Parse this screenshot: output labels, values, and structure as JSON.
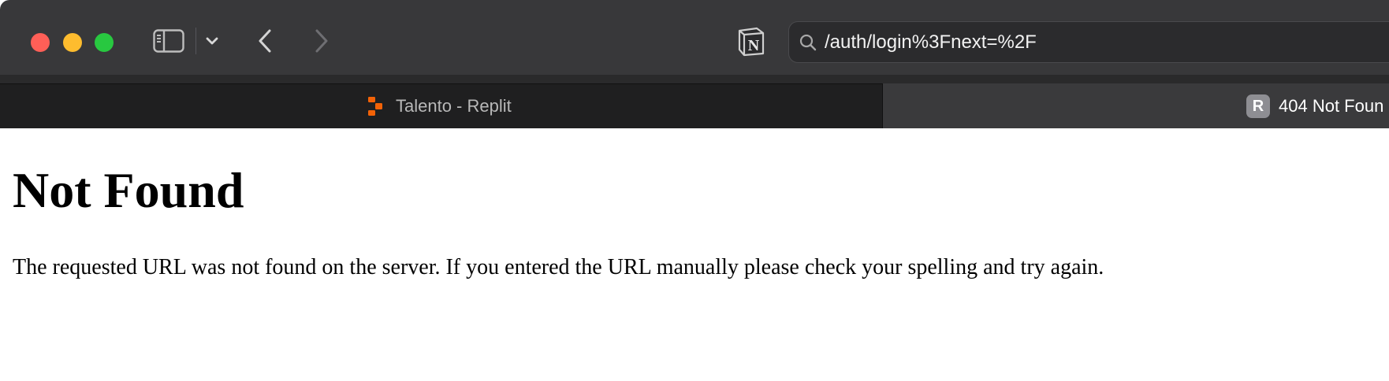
{
  "browser": {
    "address_bar": {
      "url_text": "/auth/login%3Fnext=%2F"
    },
    "toolbar_icons": [
      "sidebar-icon",
      "chevron-down-icon",
      "back-arrow-icon",
      "forward-arrow-icon",
      "notion-icon",
      "search-icon"
    ],
    "tabs": [
      {
        "title": "Talento - Replit",
        "active": false,
        "favicon": "replit-icon"
      },
      {
        "title": "404 Not Foun",
        "active": true,
        "favicon_letter": "R"
      }
    ],
    "colors": {
      "toolbar_bg": "#38383a",
      "close": "#ff5f57",
      "minimize": "#febc2e",
      "maximize": "#28c840",
      "replit_orange": "#f26207"
    }
  },
  "page": {
    "heading": "Not Found",
    "message": "The requested URL was not found on the server. If you entered the URL manually please check your spelling and try again."
  }
}
